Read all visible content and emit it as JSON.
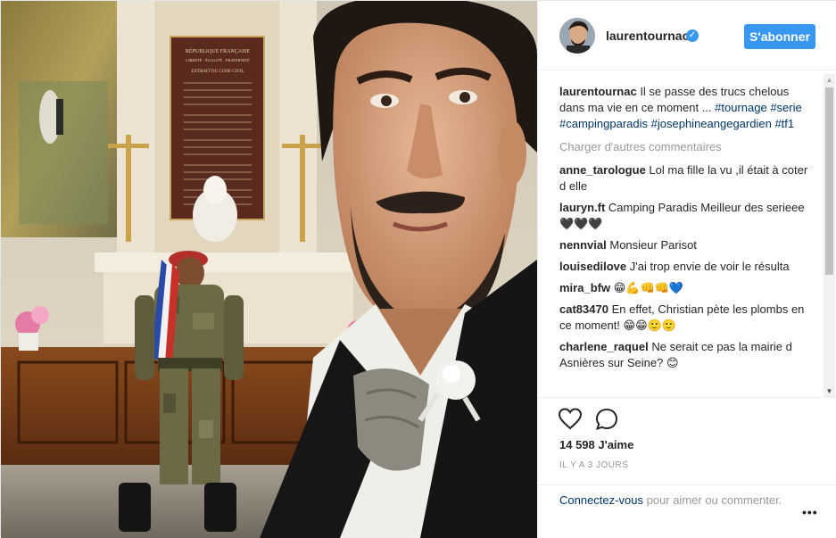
{
  "header": {
    "username": "laurentournac",
    "verified_icon": "verified-badge-icon",
    "follow_label": "S'abonner"
  },
  "caption": {
    "user": "laurentournac",
    "text": "Il se passe des trucs chelous dans ma vie en ce moment ... ",
    "hashtags": [
      "#tournage",
      "#serie",
      "#campingparadis",
      "#josephineangegardien",
      "#tf1"
    ]
  },
  "load_more": "Charger d'autres commentaires",
  "comments": [
    {
      "user": "anne_tarologue",
      "text": "Lol ma fille la vu ,il était à coter d elle"
    },
    {
      "user": "lauryn.ft",
      "text": "Camping Paradis Meilleur des serieee 🖤🖤🖤"
    },
    {
      "user": "nennvial",
      "text": "Monsieur Parisot"
    },
    {
      "user": "louisedilove",
      "text": "J'ai trop envie de voir le résulta"
    },
    {
      "user": "mira_bfw",
      "text": "😁💪👊👊💙"
    },
    {
      "user": "cat83470",
      "text": "En effet, Christian pète les plombs en ce moment! 😁😁🙂🙂"
    },
    {
      "user": "charlene_raquel",
      "text": "Ne serait ce pas la mairie d Asnières sur Seine? 😊"
    }
  ],
  "actions": {
    "like_icon": "heart-icon",
    "comment_icon": "comment-bubble-icon",
    "likes": "14 598 J'aime",
    "timestamp": "IL Y A 3 JOURS"
  },
  "login": {
    "link": "Connectez-vous",
    "rest": " pour aimer ou commenter.",
    "more": "•••"
  },
  "photo": {
    "plaque_lines": [
      "RÉPUBLIQUE FRANÇAISE",
      "LIBERTÉ · ÉGALITÉ · FRATERNITÉ",
      "EXTRAIT DU CODE CIVIL"
    ]
  },
  "colors": {
    "accent": "#3897f0",
    "hashtag": "#003569",
    "muted": "#999999"
  }
}
